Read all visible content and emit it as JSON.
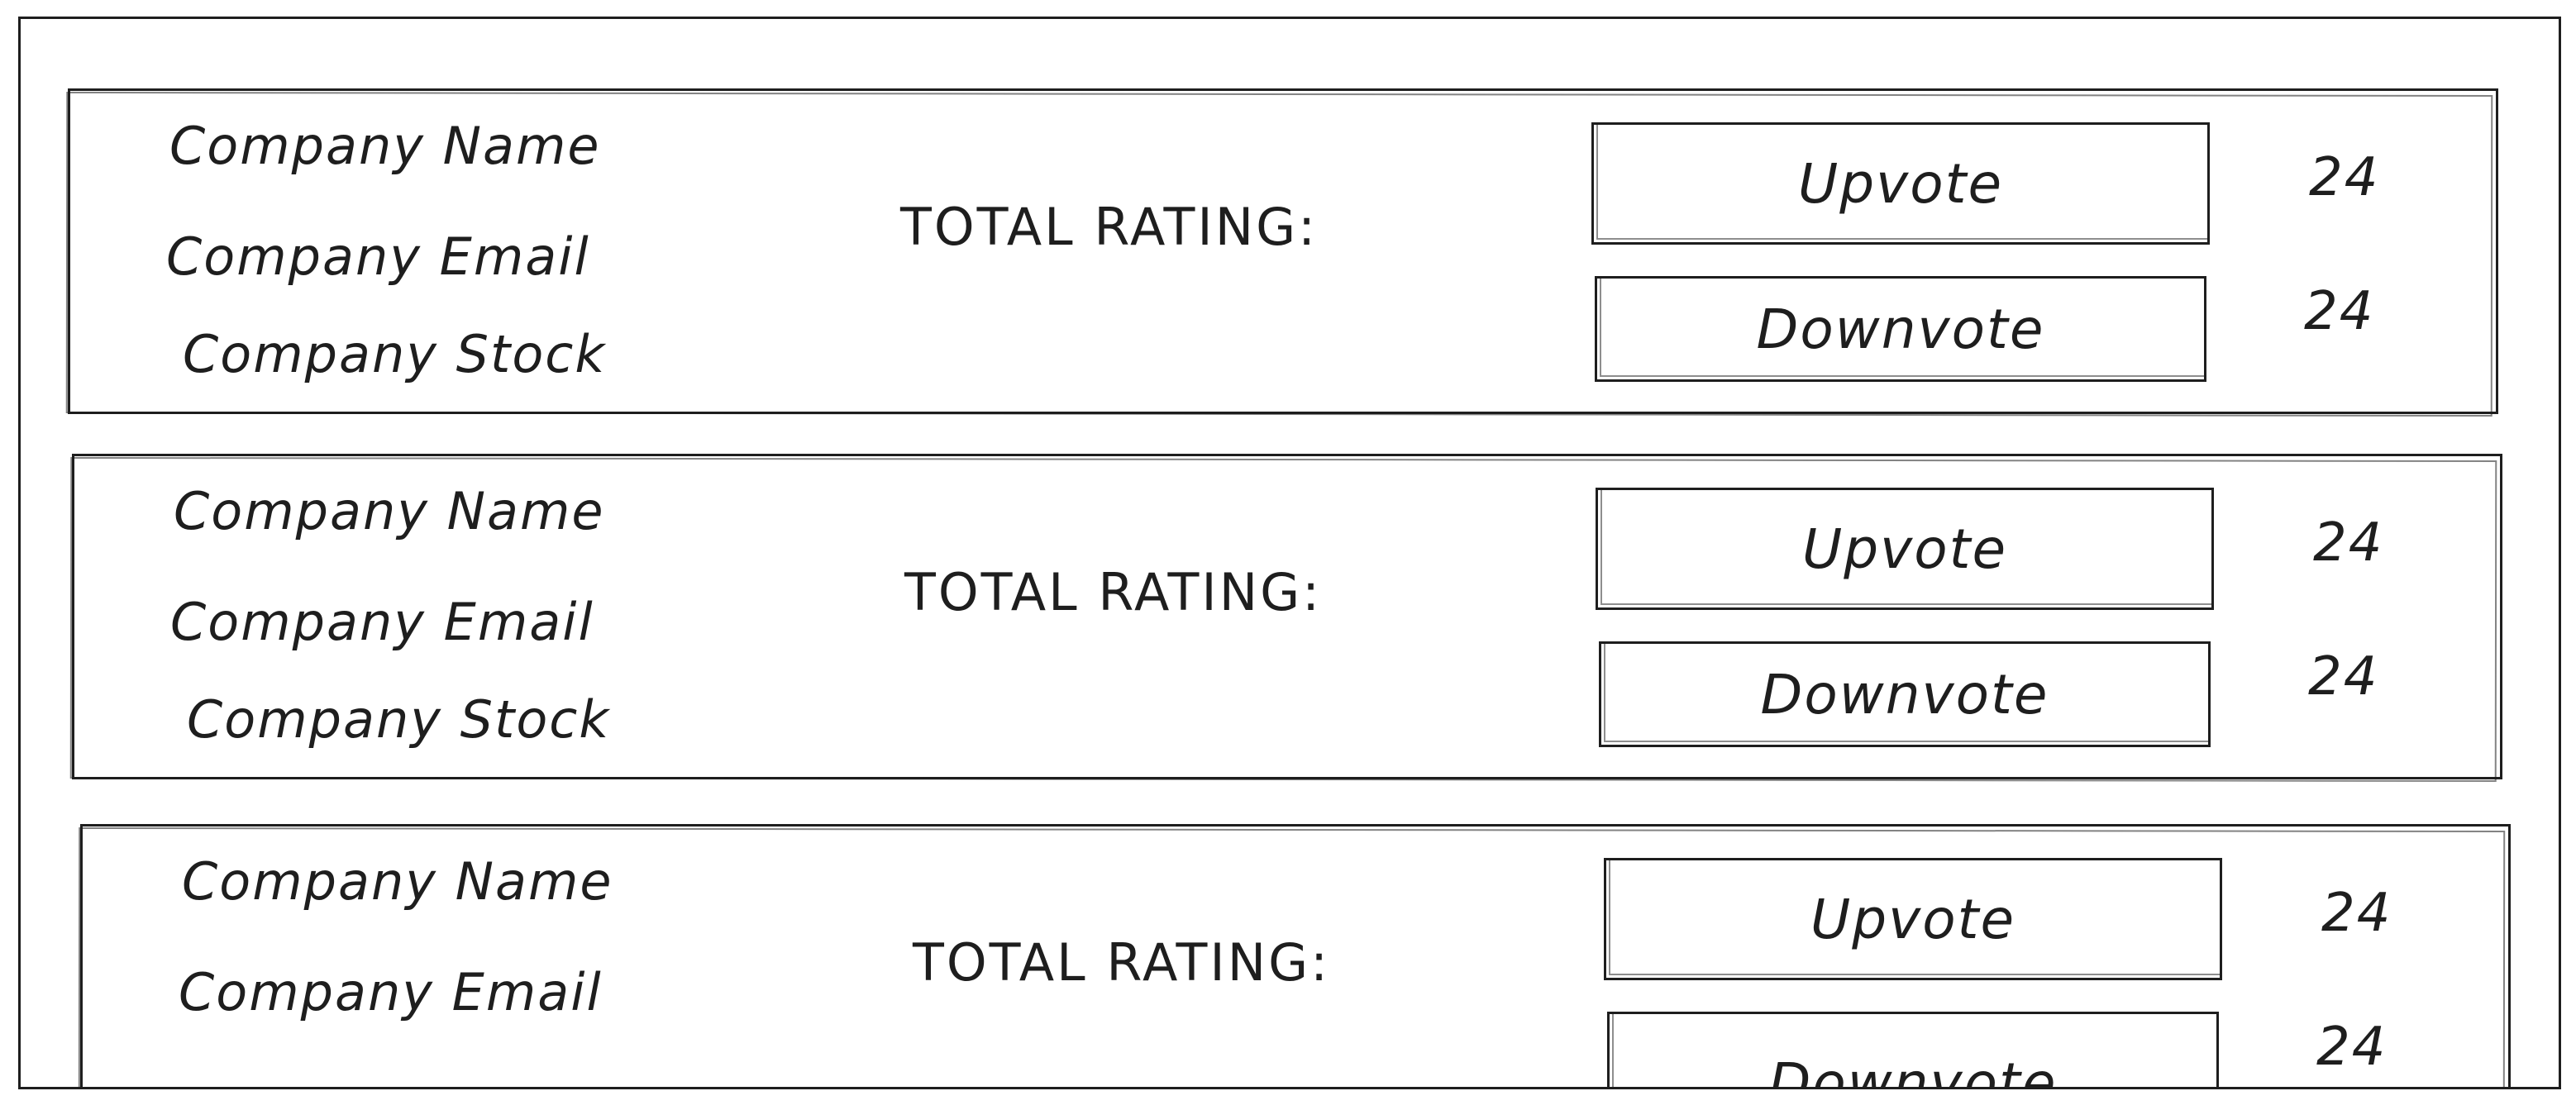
{
  "companies": [
    {
      "name_label": "Company Name",
      "email_label": "Company Email",
      "stock_label": "Company Stock",
      "total_rating_label": "TOTAL RATING:",
      "upvote_label": "Upvote",
      "downvote_label": "Downvote",
      "upvote_count": "24",
      "downvote_count": "24"
    },
    {
      "name_label": "Company Name",
      "email_label": "Company Email",
      "stock_label": "Company Stock",
      "total_rating_label": "TOTAL RATING:",
      "upvote_label": "Upvote",
      "downvote_label": "Downvote",
      "upvote_count": "24",
      "downvote_count": "24"
    },
    {
      "name_label": "Company Name",
      "email_label": "Company Email",
      "total_rating_label": "TOTAL RATING:",
      "upvote_label": "Upvote",
      "downvote_label": "Downvote",
      "upvote_count": "24",
      "downvote_count": "24"
    }
  ]
}
